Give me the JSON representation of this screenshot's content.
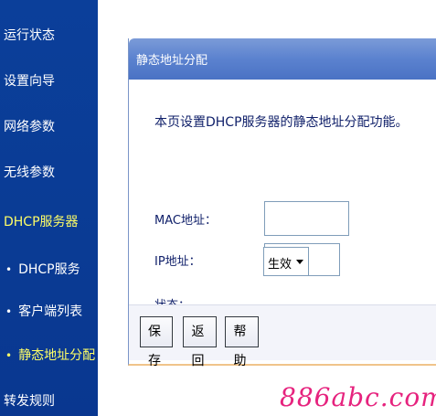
{
  "sidebar": {
    "items": [
      {
        "label": "运行状态"
      },
      {
        "label": "设置向导"
      },
      {
        "label": "网络参数"
      },
      {
        "label": "无线参数"
      },
      {
        "label": "DHCP服务器"
      },
      {
        "label": "DHCP服务"
      },
      {
        "label": "客户端列表"
      },
      {
        "label": "静态地址分配"
      },
      {
        "label": "转发规则"
      }
    ],
    "bullet": "•"
  },
  "panel": {
    "title": "静态地址分配",
    "description": "本页设置DHCP服务器的静态地址分配功能。",
    "fields": {
      "mac_label": "MAC地址：",
      "mac_value": "",
      "ip_label": "IP地址：",
      "ip_value": "",
      "status_label": "状态：",
      "status_value": "生效"
    },
    "buttons": {
      "save": "保存",
      "back": "返回",
      "help": "帮助"
    }
  },
  "watermark": "886abc.com",
  "colors": {
    "sidebar_bg": "#0b3f9a",
    "active_item": "#ffff66",
    "header_bg": "#5b82cf",
    "watermark": "#e6237e"
  }
}
